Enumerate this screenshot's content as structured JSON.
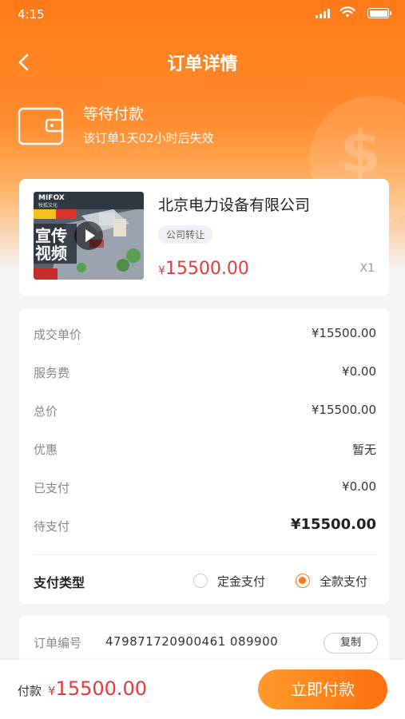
{
  "status_bar": {
    "time": "4:15"
  },
  "header": {
    "title": "订单详情"
  },
  "order_status": {
    "title": "等待付款",
    "subtitle": "该订单1天02小时后失效"
  },
  "product": {
    "name": "北京电力设备有限公司",
    "tag": "公司转让",
    "currency": "¥",
    "price": "15500.00",
    "quantity": "X1",
    "thumbnail": {
      "brand": "MIFOX",
      "brand_sub": "牧狐文化",
      "title_line1": "宣传",
      "title_line2": "视频"
    }
  },
  "fees": {
    "rows": [
      {
        "label": "成交单价",
        "value": "¥15500.00"
      },
      {
        "label": "服务费",
        "value": "¥0.00"
      },
      {
        "label": "总价",
        "value": "¥15500.00"
      },
      {
        "label": "优惠",
        "value": "暂无"
      },
      {
        "label": "已支付",
        "value": "¥0.00"
      },
      {
        "label": "待支付",
        "value": "¥15500.00"
      }
    ],
    "pay_type_label": "支付类型",
    "pay_options": [
      {
        "label": "定金支付",
        "selected": false
      },
      {
        "label": "全款支付",
        "selected": true
      }
    ]
  },
  "order_info": {
    "label": "订单编号",
    "number": "479871720900461  089900",
    "copy_label": "复制"
  },
  "bottom_bar": {
    "label": "付款",
    "currency": "¥",
    "amount": "15500.00",
    "pay_button": "立即付款"
  },
  "colors": {
    "accent": "#ff7a18",
    "price": "#e23b3b",
    "text_muted": "#888888"
  }
}
